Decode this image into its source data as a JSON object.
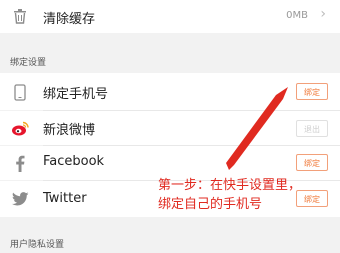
{
  "cache": {
    "label": "清除缓存",
    "value": "0MB",
    "icon": "trash-icon"
  },
  "binding_section": {
    "title": "绑定设置"
  },
  "binding_items": [
    {
      "label": "绑定手机号",
      "button": "绑定",
      "icon": "phone-icon",
      "enabled": true
    },
    {
      "label": "新浪微博",
      "button": "退出",
      "icon": "weibo-icon",
      "enabled": false
    },
    {
      "label": "Facebook",
      "button": "绑定",
      "icon": "facebook-icon",
      "enabled": true
    },
    {
      "label": "Twitter",
      "button": "绑定",
      "icon": "twitter-icon",
      "enabled": true
    }
  ],
  "privacy_section": {
    "title": "用户隐私设置"
  },
  "annotation": {
    "line1": "第一步：在快手设置里，",
    "line2": "绑定自己的手机号"
  },
  "colors": {
    "accent": "#f07a3a",
    "annotation": "#e02a20",
    "weibo": "#e6162d"
  }
}
